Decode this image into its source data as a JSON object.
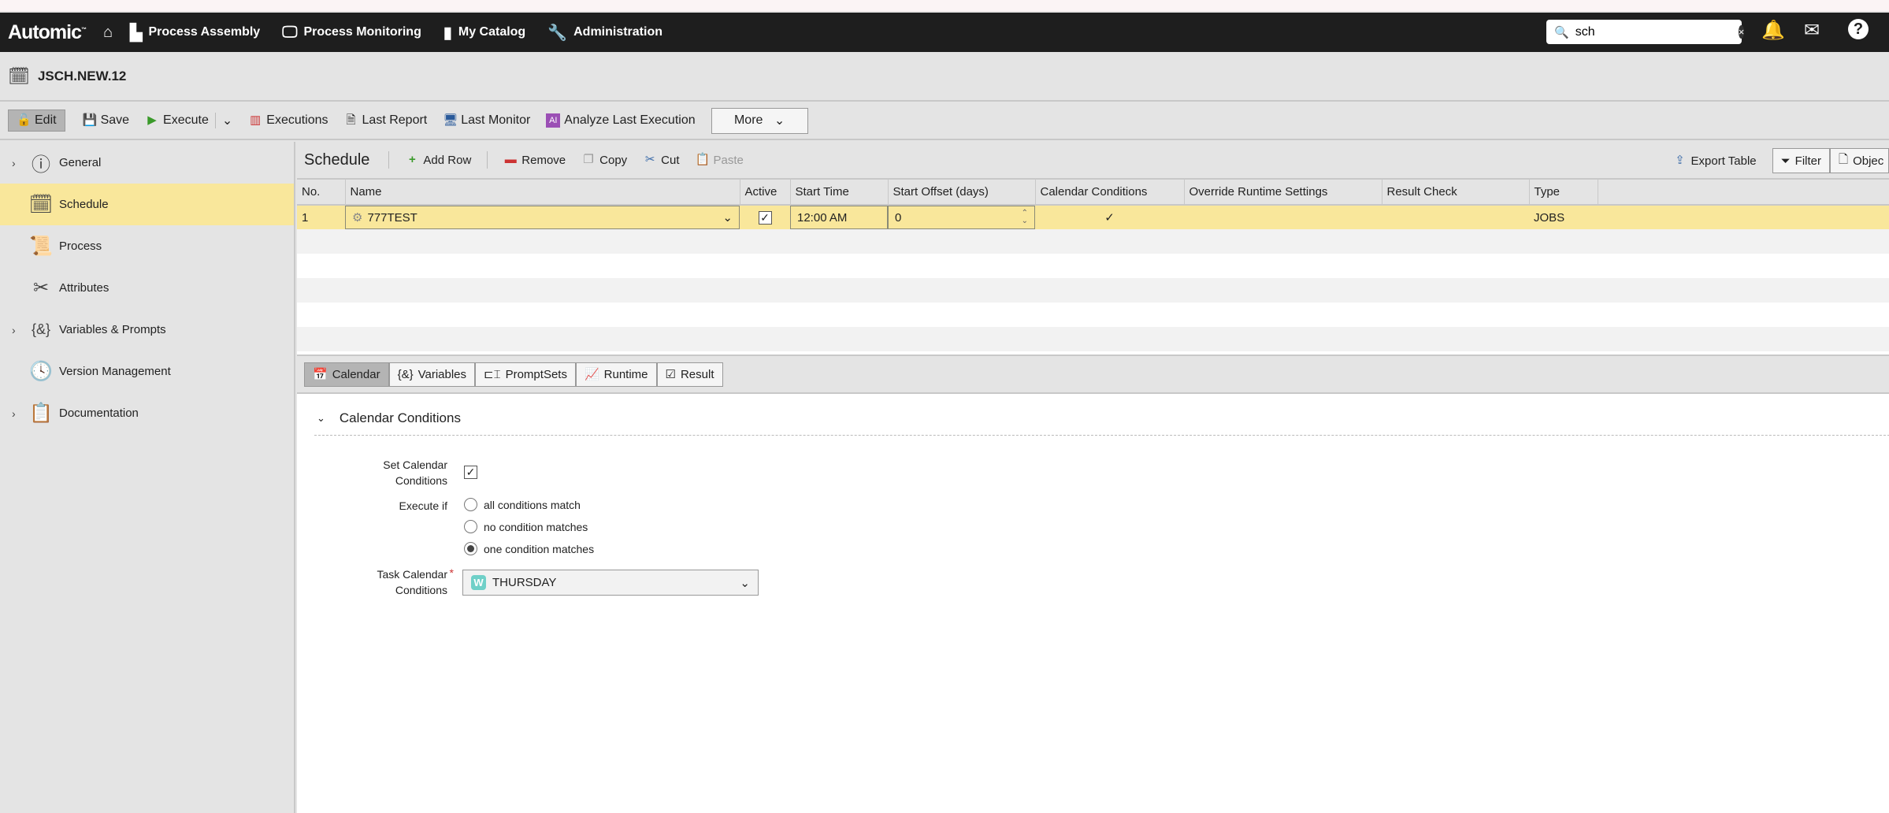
{
  "nav": {
    "logo": "Automic",
    "items": [
      "Process Assembly",
      "Process Monitoring",
      "My Catalog",
      "Administration"
    ],
    "search_value": "sch"
  },
  "title": "JSCH.NEW.12",
  "toolbar": {
    "edit": "Edit",
    "save": "Save",
    "execute": "Execute",
    "executions": "Executions",
    "last_report": "Last Report",
    "last_monitor": "Last Monitor",
    "analyze": "Analyze Last Execution",
    "more": "More"
  },
  "sidebar": {
    "items": [
      {
        "label": "General",
        "icon": "info-icon",
        "expandable": true
      },
      {
        "label": "Schedule",
        "icon": "schedule-icon",
        "selected": true
      },
      {
        "label": "Process",
        "icon": "scroll-icon"
      },
      {
        "label": "Attributes",
        "icon": "tools-icon"
      },
      {
        "label": "Variables & Prompts",
        "icon": "variables-icon",
        "expandable": true
      },
      {
        "label": "Version Management",
        "icon": "clock-icon"
      },
      {
        "label": "Documentation",
        "icon": "clipboard-icon",
        "expandable": true
      }
    ]
  },
  "schedule": {
    "title": "Schedule",
    "add_row": "Add Row",
    "remove": "Remove",
    "copy": "Copy",
    "cut": "Cut",
    "paste": "Paste",
    "export": "Export Table",
    "filter": "Filter",
    "object": "Objec"
  },
  "table": {
    "columns": [
      "No.",
      "Name",
      "Active",
      "Start Time",
      "Start Offset (days)",
      "Calendar Conditions",
      "Override Runtime Settings",
      "Result Check",
      "Type"
    ],
    "rows": [
      {
        "no": "1",
        "name": "777TEST",
        "active": true,
        "start_time": "12:00 AM",
        "offset": "0",
        "calendar_conditions": "✓",
        "override": "",
        "result_check": "",
        "type": "JOBS"
      }
    ]
  },
  "tabs": [
    "Calendar",
    "Variables",
    "PromptSets",
    "Runtime",
    "Result"
  ],
  "calendar": {
    "section": "Calendar Conditions",
    "set_label": "Set Calendar Conditions",
    "set_checked": true,
    "execute_if": "Execute if",
    "options": [
      "all conditions match",
      "no condition matches",
      "one condition matches"
    ],
    "selected": "one condition matches",
    "task_label": "Task Calendar Conditions",
    "task_value": "THURSDAY",
    "task_badge": "W"
  }
}
